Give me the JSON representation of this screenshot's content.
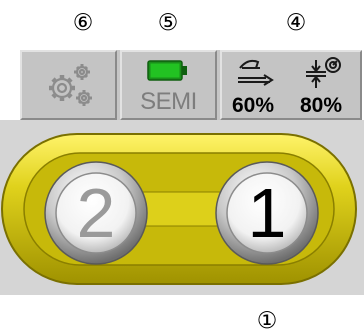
{
  "markers": {
    "settings": "⑥",
    "mode": "⑤",
    "speed": "④",
    "active_hand": "①"
  },
  "toolbar": {
    "settings_icon": "gears-icon",
    "mode": {
      "icon": "battery-icon",
      "label": "SEMI"
    },
    "speed": {
      "open_icon": "hand-open-icon",
      "close_icon": "grip-close-icon",
      "open_speed": "60%",
      "close_speed": "80%"
    }
  },
  "hands": {
    "inactive": {
      "label": "2"
    },
    "active": {
      "label": "1"
    }
  },
  "colors": {
    "battery": "#1db61d",
    "pill": "#d9cc1c",
    "pill_dark": "#8f8400",
    "active_number": "#000000",
    "inactive_number": "#9a9a9a"
  }
}
